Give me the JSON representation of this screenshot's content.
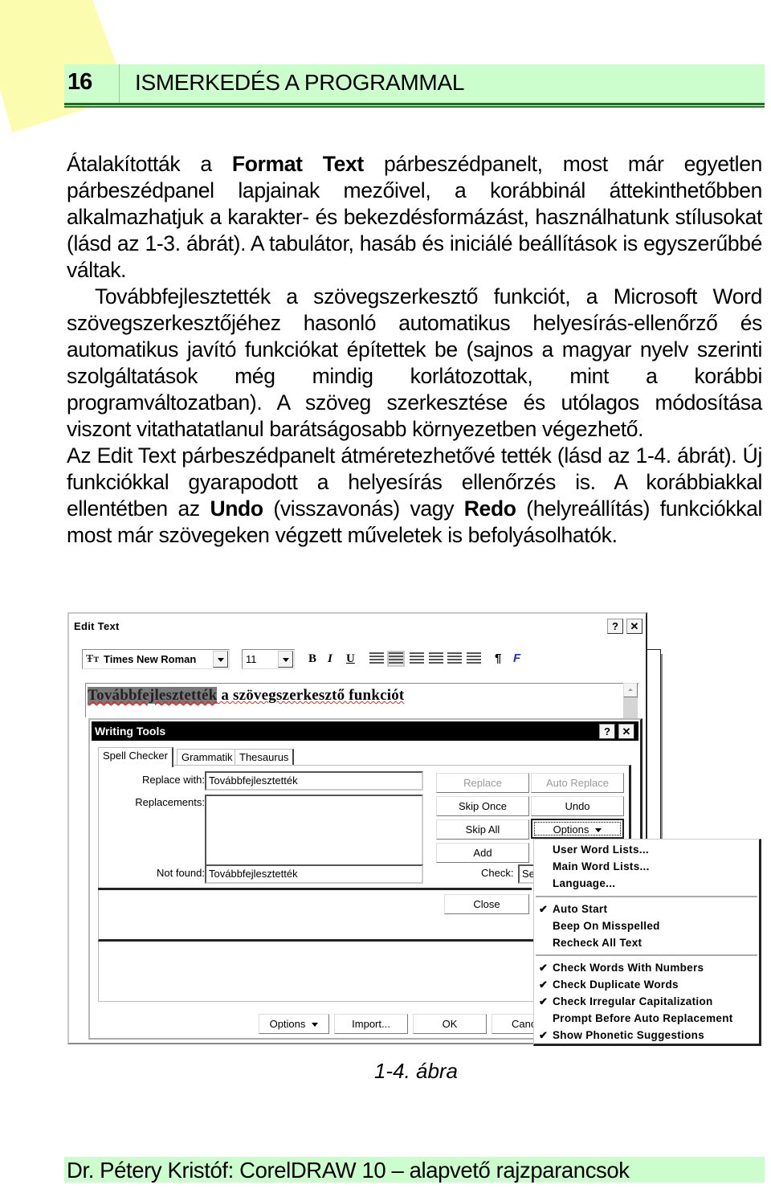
{
  "header": {
    "page_number": "16",
    "chapter_title": "ISMERKEDÉS A PROGRAMMAL"
  },
  "body": {
    "p1": {
      "before": "Átalakították a ",
      "bold": "Format Text",
      "after": " párbeszédpanelt, most már egyetlen párbeszédpanel lapjainak mezőivel, a korábbinál áttekinthetőbben alkalmazhatjuk a karakter- és bekezdésformázást, használhatunk stílusokat (lásd az 1-3. ábrát). A tabulátor, hasáb és iniciálé beállítások is egyszerűbbé váltak."
    },
    "p2": "Továbbfejlesztették a szövegszerkesztő funkciót, a Microsoft Word szövegszerkesztőjéhez hasonló automatikus helyesírás-ellenőrző és automatikus javító funkciókat építettek be (sajnos a magyar nyelv szerinti szolgáltatások még mindig korlátozottak, mint a korábbi programváltozatban). A szöveg szerkesztése és utólagos módosítása viszont vitathatatlanul barátságosabb környezetben végezhető.",
    "p3": {
      "part1": "Az Edit Text párbeszédpanelt átméretezhetővé tették (lásd az 1-4. ábrát). Új funkciókkal gyarapodott a helyesírás ellenőrzés is. A korábbiakkal ellentétben az ",
      "bold1": "Undo",
      "part2": " (visszavonás) vagy ",
      "bold2": "Redo",
      "part3": " (helyreállítás) funkciókkal most már szövegeken végzett műveletek is befolyásolhatók."
    }
  },
  "figure": {
    "edit_text": {
      "title": "Edit Text",
      "help_button": "?",
      "close_button": "✕",
      "font_name": "Times New Roman",
      "font_icon": "Ŧᴛ",
      "font_size": "11",
      "bold_label": "B",
      "italic_label": "I",
      "underline_label": "U",
      "paragraph_label": "¶",
      "fontwork_label": "F",
      "text_selected": "Továbbfejlesztették",
      "text_rest": " a szövegszerkesztő funkciót"
    },
    "writing_tools": {
      "title": "Writing Tools",
      "help_button": "?",
      "close_button": "✕",
      "tabs": [
        "Spell Checker",
        "Grammatik",
        "Thesaurus"
      ],
      "replace_with_label": "Replace with:",
      "replace_with_value": "Továbbfejlesztették",
      "replacements_label": "Replacements:",
      "not_found_label": "Not found:",
      "not_found_value": "Továbbfejlesztették",
      "check_label": "Check:",
      "check_value": "Se",
      "buttons": {
        "replace": "Replace",
        "auto_replace": "Auto Replace",
        "skip_once": "Skip Once",
        "undo": "Undo",
        "skip_all": "Skip All",
        "options": "Options",
        "add": "Add",
        "close": "Close"
      },
      "bottom_buttons": {
        "options": "Options",
        "import": "Import...",
        "ok": "OK",
        "cancel": "Canc"
      }
    },
    "options_menu": {
      "items": [
        {
          "label": "User Word Lists...",
          "checked": false
        },
        {
          "label": "Main Word Lists...",
          "checked": false
        },
        {
          "label": "Language...",
          "checked": false
        },
        {
          "label": "Auto Start",
          "checked": true
        },
        {
          "label": "Beep On Misspelled",
          "checked": false
        },
        {
          "label": "Recheck All Text",
          "checked": false
        },
        {
          "label": "Check Words With Numbers",
          "checked": true
        },
        {
          "label": "Check Duplicate Words",
          "checked": true
        },
        {
          "label": "Check Irregular Capitalization",
          "checked": true
        },
        {
          "label": "Prompt Before Auto Replacement",
          "checked": false
        },
        {
          "label": "Show Phonetic Suggestions",
          "checked": true
        }
      ],
      "check_glyph": "✔"
    },
    "caption": "1-4. ábra"
  },
  "footer": {
    "text": "Dr. Pétery Kristóf: CorelDRAW 10 – alapvető rajzparancsok"
  },
  "colors": {
    "header_band": "#ccfdcc",
    "header_rule": "#1e6e1e",
    "deco_yellow": "#fbfba0",
    "fontwork_blue": "#1a2fd0"
  }
}
